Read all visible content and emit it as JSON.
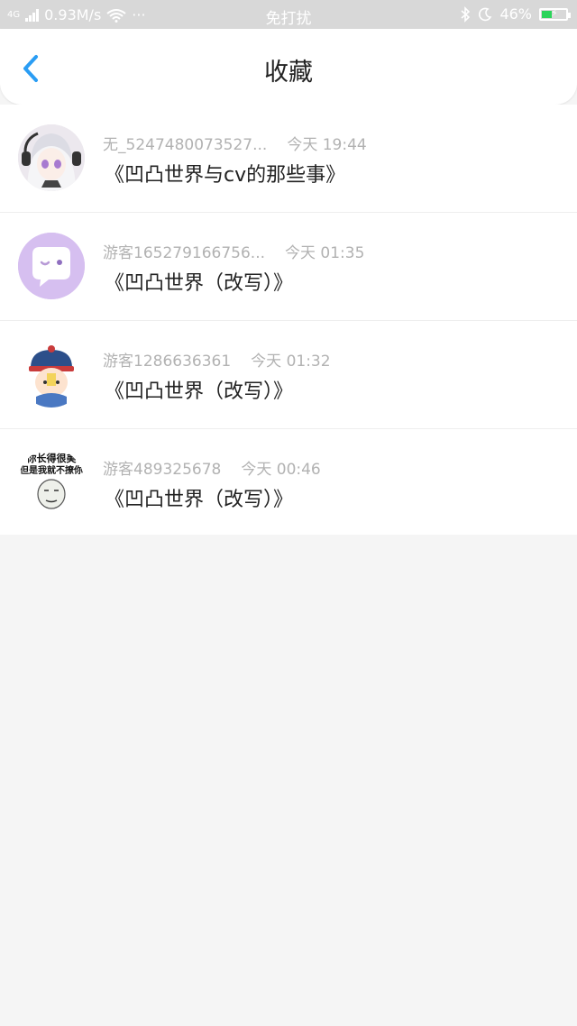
{
  "status_bar": {
    "network": "4G",
    "speed": "0.93M/s",
    "dots": "···",
    "mode": "免打扰",
    "battery": "46%",
    "battery_level": 0.46
  },
  "header": {
    "title": "收藏"
  },
  "favorites": [
    {
      "user": "无_5247480073527...",
      "time": "今天 19:44",
      "title": "《凹凸世界与cv的那些事》"
    },
    {
      "user": "游客165279166756...",
      "time": "今天 01:35",
      "title": "《凹凸世界（改写）》"
    },
    {
      "user": "游客1286636361",
      "time": "今天 01:32",
      "title": "《凹凸世界（改写）》"
    },
    {
      "user": "游客489325678",
      "time": "今天 00:46",
      "title": "《凹凸世界（改写）》"
    }
  ],
  "avatars": {
    "sticker_text_line1": "你长得很美",
    "sticker_text_line2": "但是我就不撩你"
  },
  "colors": {
    "accent": "#2a9df4",
    "status_bar_bg": "#d8d8d8",
    "page_bg": "#f5f5f5",
    "battery_fill": "#2bd45a"
  }
}
